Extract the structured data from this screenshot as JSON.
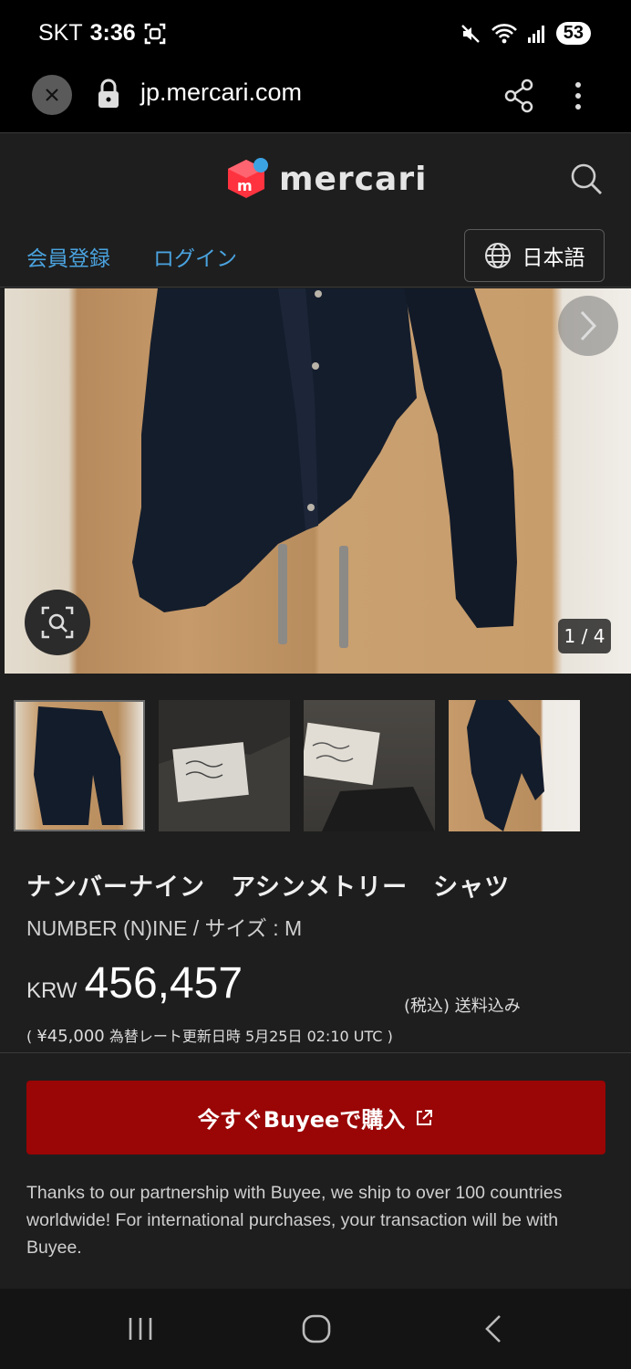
{
  "status_bar": {
    "carrier": "SKT",
    "time": "3:36",
    "battery": "53"
  },
  "browser": {
    "url": "jp.mercari.com"
  },
  "header": {
    "logo_text": "mercari",
    "signup": "会員登録",
    "login": "ログイン",
    "language": "日本語"
  },
  "gallery": {
    "counter": "1 / 4"
  },
  "product": {
    "title": "ナンバーナイン　アシンメトリー　シャツ",
    "subtitle": "NUMBER (N)INE / サイズ : M",
    "currency": "KRW",
    "price": "456,457",
    "tax_note": "(税込) 送料込み",
    "fx_open": "( ",
    "fx_yen": "¥45,000",
    "fx_rest": " 為替レート更新日時 5月25日 02:10 UTC )"
  },
  "buy": {
    "label": "今すぐBuyeeで購入"
  },
  "note": "Thanks to our partnership with Buyee, we ship to over 100 countries worldwide! For international purchases, your transaction will be with Buyee.",
  "colors": {
    "accent_link": "#4aa3df",
    "buy_button": "#9a0505",
    "logo_red": "#ff333f",
    "logo_blue": "#3ca3e3"
  }
}
